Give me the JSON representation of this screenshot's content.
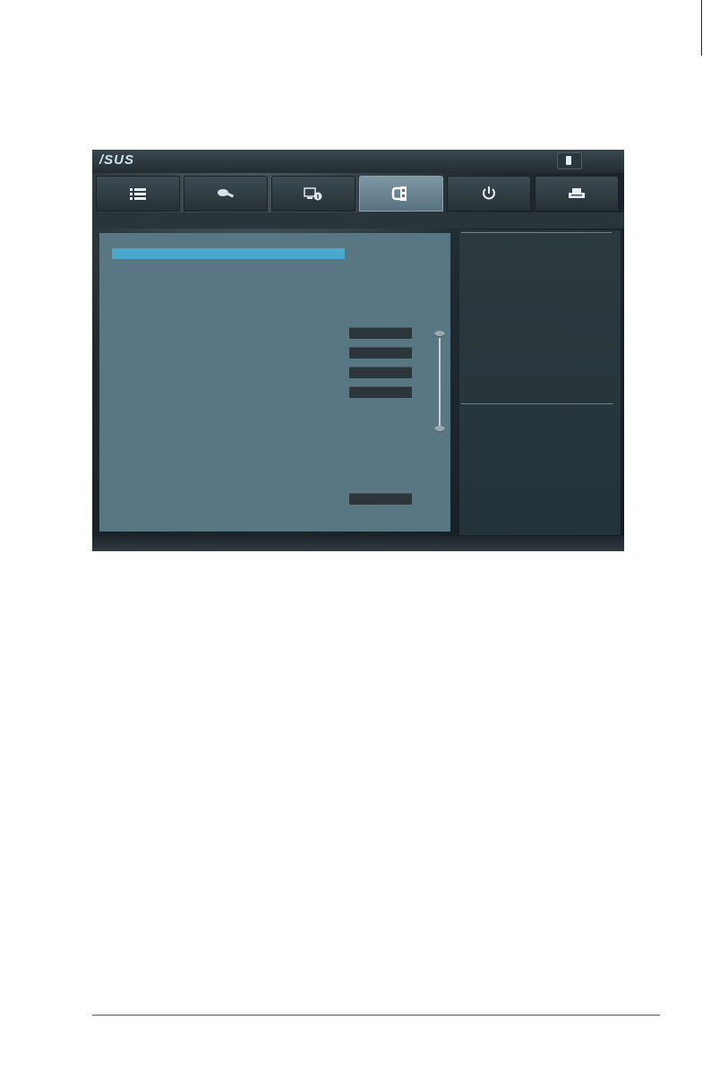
{
  "window": {
    "logo_text": "/SUS"
  },
  "tabs": [
    {
      "icon": "list-icon",
      "active": false
    },
    {
      "icon": "tools-icon",
      "active": false
    },
    {
      "icon": "monitor-info-icon",
      "active": false
    },
    {
      "icon": "boot-chip-icon",
      "active": true
    },
    {
      "icon": "power-icon",
      "active": false
    },
    {
      "icon": "printer-tool-icon",
      "active": false
    }
  ],
  "colors": {
    "panel": "#587783",
    "selection": "#49a8cb",
    "active_tab": "#7f98a6"
  }
}
